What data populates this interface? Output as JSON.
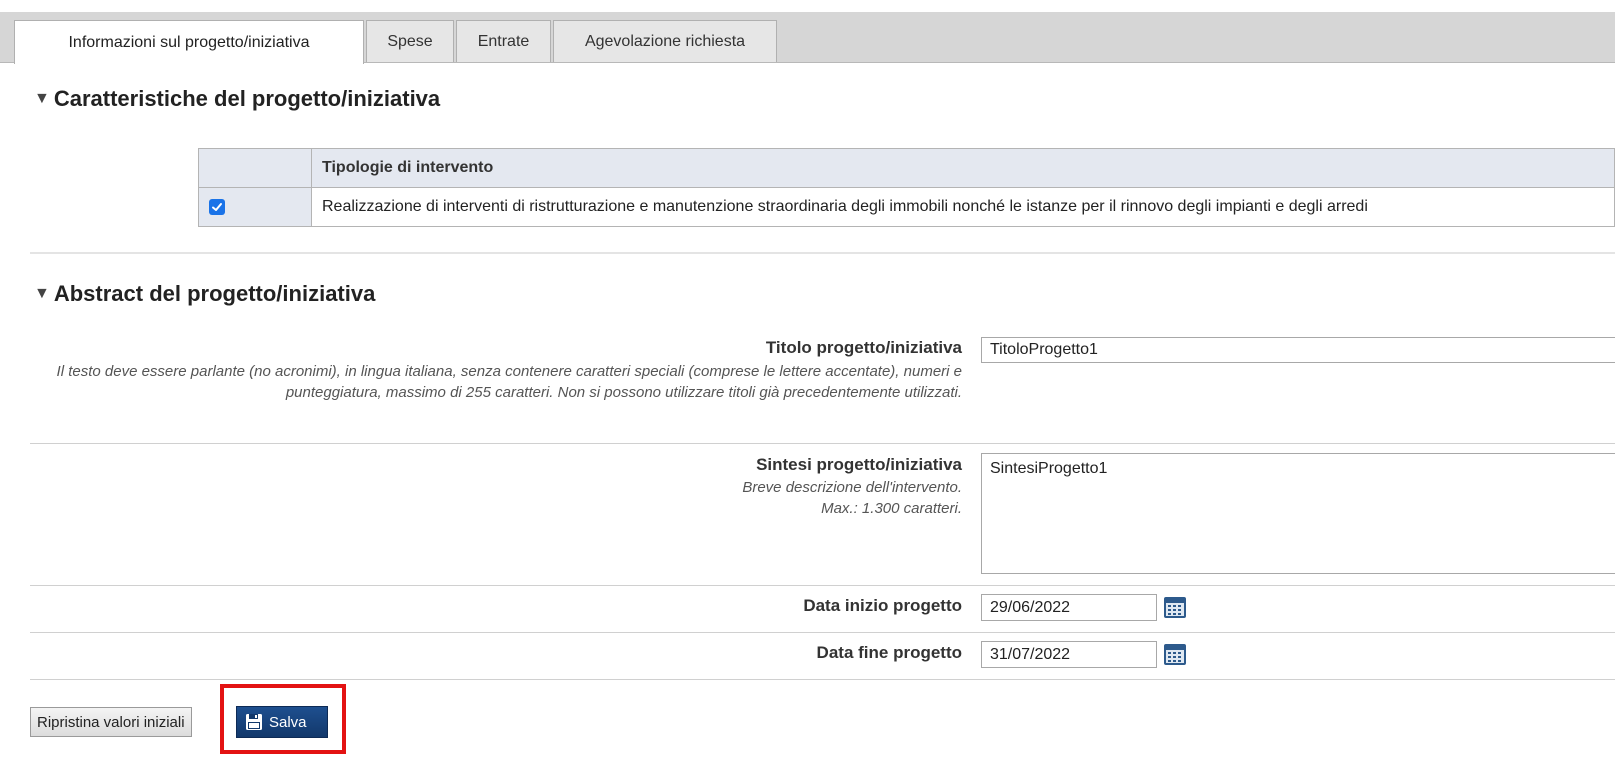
{
  "tabs": [
    {
      "label": "Informazioni sul progetto/iniziativa",
      "active": true
    },
    {
      "label": "Spese",
      "active": false
    },
    {
      "label": "Entrate",
      "active": false
    },
    {
      "label": "Agevolazione richiesta",
      "active": false
    }
  ],
  "section_caratteristiche": {
    "title": "Caratteristiche del progetto/iniziativa",
    "table": {
      "header": "Tipologie di intervento",
      "rows": [
        {
          "checked": true,
          "text": "Realizzazione di interventi di ristrutturazione e manutenzione straordinaria degli immobili nonché le istanze per il rinnovo degli impianti e degli arredi"
        }
      ]
    }
  },
  "section_abstract": {
    "title": "Abstract del progetto/iniziativa",
    "titolo": {
      "label": "Titolo progetto/iniziativa",
      "hint": "Il testo deve essere parlante (no acronimi), in lingua italiana, senza contenere caratteri speciali (comprese le lettere accentate), numeri e punteggiatura, massimo di 255 caratteri. Non si possono utilizzare titoli già precedentemente utilizzati.",
      "value": "TitoloProgetto1"
    },
    "sintesi": {
      "label": "Sintesi progetto/iniziativa",
      "hint_line1": "Breve descrizione dell'intervento.",
      "hint_line2": "Max.: 1.300 caratteri.",
      "value": "SintesiProgetto1"
    },
    "data_inizio": {
      "label": "Data inizio progetto",
      "value": "29/06/2022"
    },
    "data_fine": {
      "label": "Data fine progetto",
      "value": "31/07/2022"
    }
  },
  "buttons": {
    "reset_label": "Ripristina valori iniziali",
    "save_label": "Salva"
  },
  "colors": {
    "highlight": "#e31212",
    "save_button": "#1e4f8f",
    "checkbox": "#1a73e8"
  },
  "icons": {
    "section_toggle": "triangle-down-icon",
    "calendar": "calendar-icon",
    "save": "floppy-disk-icon"
  }
}
